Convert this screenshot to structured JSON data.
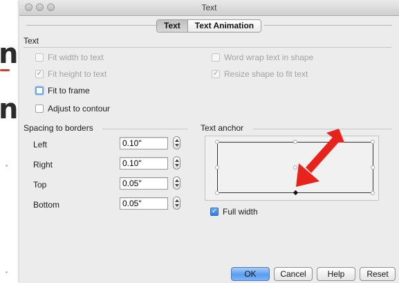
{
  "window": {
    "title": "Text"
  },
  "tabs": [
    {
      "label": "Text",
      "selected": true
    },
    {
      "label": "Text Animation",
      "selected": false
    }
  ],
  "text_section": {
    "label": "Text",
    "options": {
      "fit_width": {
        "label": "Fit width to text",
        "checked": false,
        "enabled": false
      },
      "word_wrap": {
        "label": "Word wrap text in shape",
        "checked": false,
        "enabled": false
      },
      "fit_height": {
        "label": "Fit height to text",
        "checked": true,
        "enabled": false
      },
      "resize_shape": {
        "label": "Resize shape to fit text",
        "checked": true,
        "enabled": false
      },
      "fit_frame": {
        "label": "Fit to frame",
        "checked": false,
        "enabled": true,
        "focused": true
      },
      "adjust_contour": {
        "label": "Adjust to contour",
        "checked": false,
        "enabled": true
      }
    }
  },
  "spacing": {
    "label": "Spacing to borders",
    "fields": [
      {
        "label": "Left",
        "value": "0.10\""
      },
      {
        "label": "Right",
        "value": "0.10\""
      },
      {
        "label": "Top",
        "value": "0.05\""
      },
      {
        "label": "Bottom",
        "value": "0.05\""
      }
    ]
  },
  "anchor": {
    "label": "Text anchor",
    "selected": "bottom-center",
    "full_width": {
      "label": "Full width",
      "checked": true
    }
  },
  "buttons": {
    "ok": "OK",
    "cancel": "Cancel",
    "help": "Help",
    "reset": "Reset"
  },
  "background_window": {
    "glyph_top": "n",
    "glyph_bottom": "n"
  },
  "colors": {
    "arrow_red": "#e8231c",
    "accent_blue": "#2f7ce0"
  }
}
